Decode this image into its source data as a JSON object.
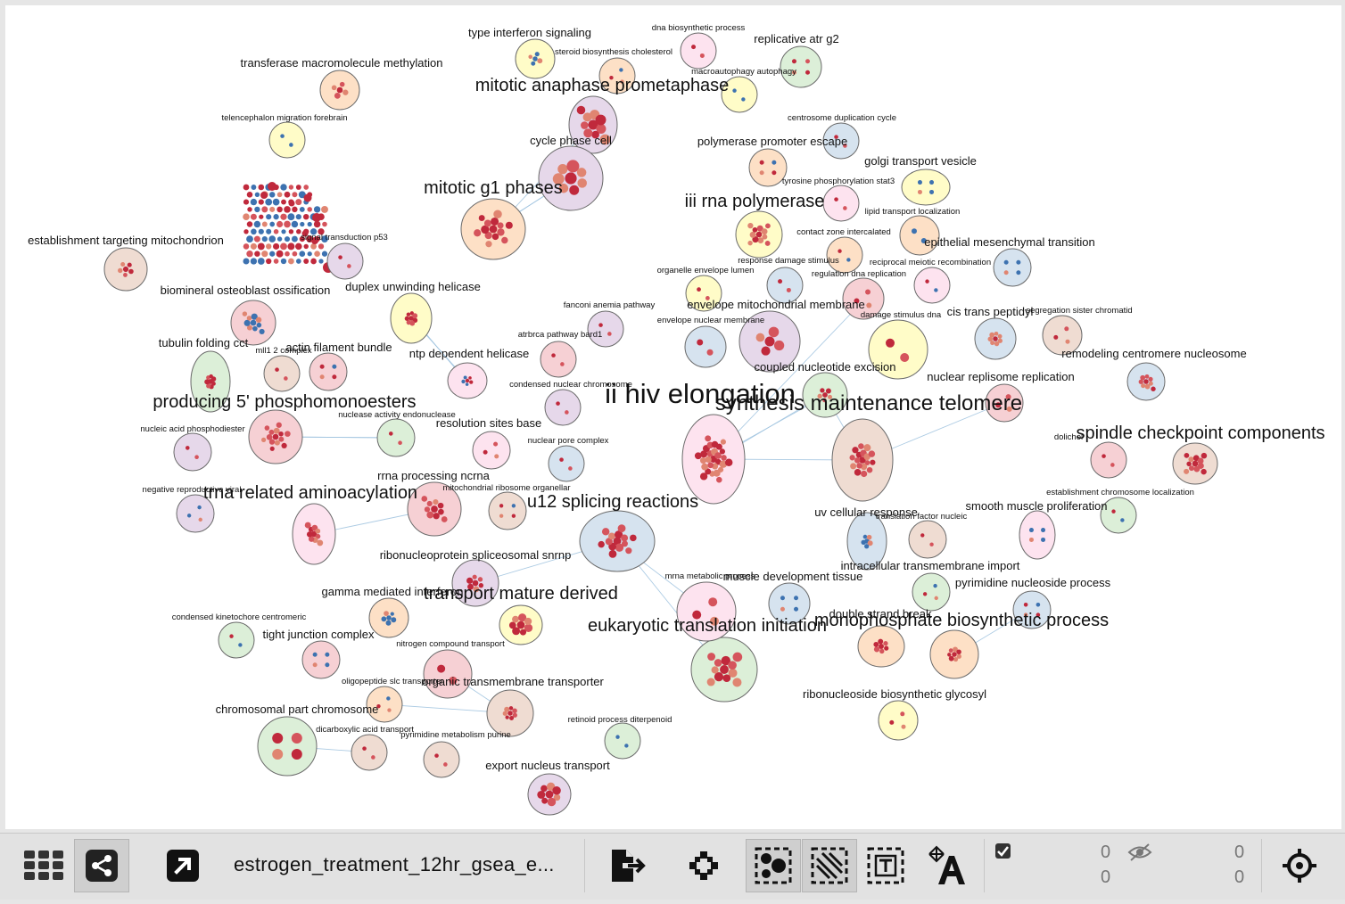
{
  "colors": {
    "yellow": "#fffcc8",
    "peach": "#fde0c6",
    "pink": "#fde3ef",
    "green": "#dcefd8",
    "blue": "#d6e3ef",
    "purple": "#e6d8ea",
    "tan": "#efdcd2",
    "rose": "#f6d0d4",
    "dot_dark": "#c0293c",
    "dot_mid": "#d5545c",
    "dot_light": "#e08571",
    "dot_blue": "#3d72b0",
    "edge": "#9fc3df"
  },
  "network": {
    "clusters": [
      {
        "label": "ii hiv elongation",
        "size": "xl"
      },
      {
        "label": "synthesis maintenance telomere",
        "size": "lg"
      },
      {
        "label": "spindle checkpoint components",
        "size": "md"
      },
      {
        "label": "mitotic anaphase prometaphase",
        "size": "md"
      },
      {
        "label": "mitotic g1 phases",
        "size": "md"
      },
      {
        "label": "producing 5' phosphomonoesters",
        "size": "md"
      },
      {
        "label": "trna related aminoacylation",
        "size": "md"
      },
      {
        "label": "u12 splicing reactions",
        "size": "md"
      },
      {
        "label": "transport mature derived",
        "size": "md"
      },
      {
        "label": "eukaryotic translation initiation",
        "size": "md"
      },
      {
        "label": "monophosphate biosynthetic process",
        "size": "md"
      },
      {
        "label": "iii rna polymerase",
        "size": "md"
      },
      {
        "label": "export nucleus transport",
        "size": "sm"
      },
      {
        "label": "cycle phase cell",
        "size": "sm"
      },
      {
        "label": "type interferon signaling",
        "size": "sm"
      },
      {
        "label": "replicative atr g2",
        "size": "sm"
      },
      {
        "label": "transferase macromolecule methylation",
        "size": "sm"
      },
      {
        "label": "establishment targeting mitochondrion",
        "size": "sm"
      },
      {
        "label": "biomineral osteoblast ossification",
        "size": "sm"
      },
      {
        "label": "tubulin folding cct",
        "size": "sm"
      },
      {
        "label": "actin filament bundle",
        "size": "sm"
      },
      {
        "label": "duplex unwinding helicase",
        "size": "sm"
      },
      {
        "label": "ntp dependent helicase",
        "size": "sm"
      },
      {
        "label": "resolution sites base",
        "size": "sm"
      },
      {
        "label": "rrna processing ncrna",
        "size": "sm"
      },
      {
        "label": "ribonucleoprotein spliceosomal snrnp",
        "size": "sm"
      },
      {
        "label": "gamma mediated interferon",
        "size": "sm"
      },
      {
        "label": "tight junction complex",
        "size": "sm"
      },
      {
        "label": "organic transmembrane transporter",
        "size": "sm"
      },
      {
        "label": "chromosomal part chromosome",
        "size": "sm"
      },
      {
        "label": "golgi transport vesicle",
        "size": "sm"
      },
      {
        "label": "polymerase promoter escape",
        "size": "sm"
      },
      {
        "label": "epithelial mesenchymal transition",
        "size": "sm"
      },
      {
        "label": "envelope mitochondrial membrane",
        "size": "sm"
      },
      {
        "label": "cis trans peptidyl",
        "size": "sm"
      },
      {
        "label": "remodeling centromere nucleosome",
        "size": "sm"
      },
      {
        "label": "coupled nucleotide excision",
        "size": "sm"
      },
      {
        "label": "nuclear replisome replication",
        "size": "sm"
      },
      {
        "label": "uv cellular response",
        "size": "sm"
      },
      {
        "label": "smooth muscle proliferation",
        "size": "sm"
      },
      {
        "label": "intracellular transmembrane import",
        "size": "sm"
      },
      {
        "label": "pyrimidine nucleoside process",
        "size": "sm"
      },
      {
        "label": "double strand break",
        "size": "sm"
      },
      {
        "label": "muscle development tissue",
        "size": "sm"
      },
      {
        "label": "ribonucleoside biosynthetic glycosyl",
        "size": "sm"
      },
      {
        "label": "dna biosynthetic process",
        "size": "xs"
      },
      {
        "label": "steroid biosynthesis cholesterol",
        "size": "xs"
      },
      {
        "label": "macroautophagy autophagy",
        "size": "xs"
      },
      {
        "label": "telencephalon migration forebrain",
        "size": "xs"
      },
      {
        "label": "centrosome duplication cycle",
        "size": "xs"
      },
      {
        "label": "tyrosine phosphorylation stat3",
        "size": "xs"
      },
      {
        "label": "lipid transport localization",
        "size": "xs"
      },
      {
        "label": "signal transduction p53",
        "size": "xs"
      },
      {
        "label": "contact zone intercalated",
        "size": "xs"
      },
      {
        "label": "response damage stimulus",
        "size": "xs"
      },
      {
        "label": "reciprocal meiotic recombination",
        "size": "xs"
      },
      {
        "label": "organelle envelope lumen",
        "size": "xs"
      },
      {
        "label": "regulation dna replication",
        "size": "xs"
      },
      {
        "label": "fanconi anemia pathway",
        "size": "xs"
      },
      {
        "label": "envelope nuclear membrane",
        "size": "xs"
      },
      {
        "label": "damage stimulus dna",
        "size": "xs"
      },
      {
        "label": "segregation sister chromatid",
        "size": "xs"
      },
      {
        "label": "mll1 2 complex",
        "size": "xs"
      },
      {
        "label": "atrbrca pathway bard1",
        "size": "xs"
      },
      {
        "label": "condensed nuclear chromosome",
        "size": "xs"
      },
      {
        "label": "nuclease activity endonuclease",
        "size": "xs"
      },
      {
        "label": "nucleic acid phosphodiester",
        "size": "xs"
      },
      {
        "label": "nuclear pore complex",
        "size": "xs"
      },
      {
        "label": "dolichol",
        "size": "xs"
      },
      {
        "label": "negative reproductive viral",
        "size": "xs"
      },
      {
        "label": "mitochondrial ribosome organellar",
        "size": "xs"
      },
      {
        "label": "establishment chromosome localization",
        "size": "xs"
      },
      {
        "label": "translation factor nucleic",
        "size": "xs"
      },
      {
        "label": "mrna metabolic process",
        "size": "xs"
      },
      {
        "label": "condensed kinetochore centromeric",
        "size": "xs"
      },
      {
        "label": "nitrogen compound transport",
        "size": "xs"
      },
      {
        "label": "oligopeptide slc transporter",
        "size": "xs"
      },
      {
        "label": "dicarboxylic acid transport",
        "size": "xs"
      },
      {
        "label": "pyrimidine metabolism purine",
        "size": "xs"
      },
      {
        "label": "retinoid process diterpenoid",
        "size": "xs"
      }
    ]
  },
  "toolbar": {
    "network_name": "estrogen_treatment_12hr_gsea_e...",
    "selected_nodes_count": "0",
    "selected_edges_count": "0",
    "hidden_nodes_count": "0",
    "hidden_edges_count": "0",
    "icons": [
      "apps-grid-icon",
      "share-network-icon",
      "open-external-icon",
      "export-icon",
      "fit-layout-icon",
      "select-nodes-icon",
      "select-edges-icon",
      "select-text-icon",
      "text-size-icon",
      "checkbox-icon",
      "hidden-eye-icon",
      "crosshair-icon"
    ]
  }
}
